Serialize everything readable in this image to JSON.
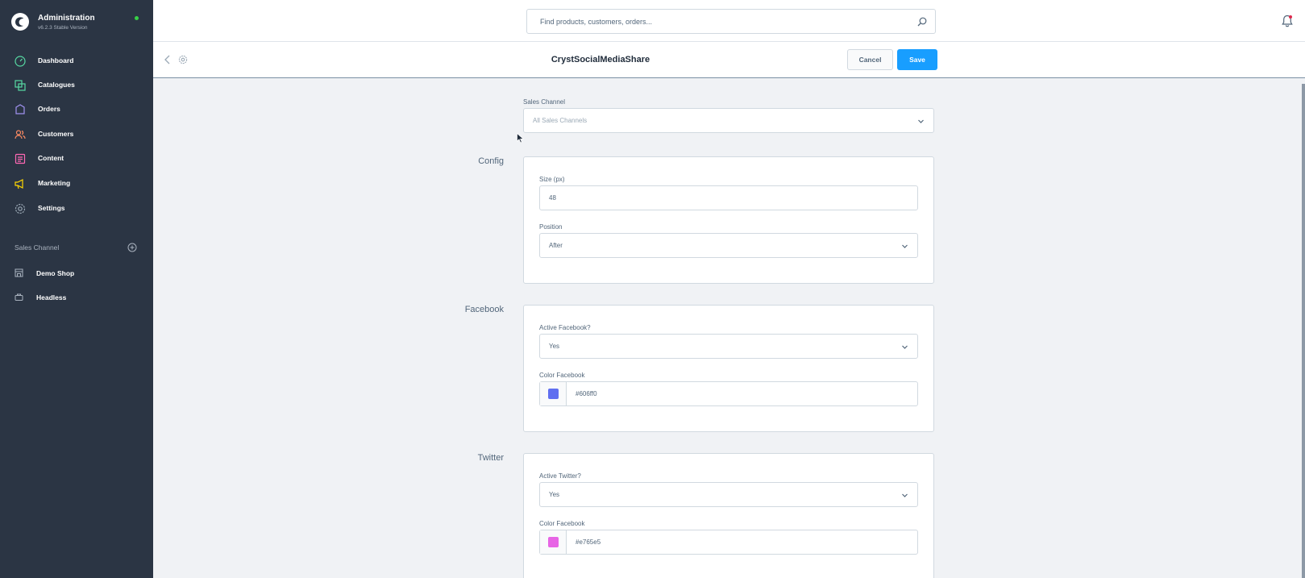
{
  "app": {
    "title": "Administration",
    "version": "v6.2.3 Stable Version"
  },
  "nav": {
    "items": [
      {
        "label": "Dashboard",
        "icon": "dashboard-icon",
        "color": "#57d9a3"
      },
      {
        "label": "Catalogues",
        "icon": "catalogues-icon",
        "color": "#57d9a3"
      },
      {
        "label": "Orders",
        "icon": "orders-icon",
        "color": "#a092f0"
      },
      {
        "label": "Customers",
        "icon": "customers-icon",
        "color": "#f88962"
      },
      {
        "label": "Content",
        "icon": "content-icon",
        "color": "#ff68b4"
      },
      {
        "label": "Marketing",
        "icon": "marketing-icon",
        "color": "#ffd700"
      },
      {
        "label": "Settings",
        "icon": "settings-icon",
        "color": "#9aa8b5"
      }
    ],
    "sales_channel_heading": "Sales Channel",
    "sales_channels": [
      {
        "label": "Demo Shop",
        "icon": "storefront-icon"
      },
      {
        "label": "Headless",
        "icon": "headless-icon"
      }
    ]
  },
  "search": {
    "placeholder": "Find products, customers, orders..."
  },
  "smartbar": {
    "title": "CrystSocialMediaShare",
    "cancel_label": "Cancel",
    "save_label": "Save"
  },
  "form": {
    "sales_channel": {
      "label": "Sales Channel",
      "placeholder": "All Sales Channels"
    },
    "config": {
      "title": "Config",
      "size_label": "Size (px)",
      "size_value": "48",
      "position_label": "Position",
      "position_value": "After"
    },
    "facebook": {
      "title": "Facebook",
      "active_label": "Active Facebook?",
      "active_value": "Yes",
      "color_label": "Color Facebook",
      "color_value": "#606ff0",
      "swatch": "#606ff0"
    },
    "twitter": {
      "title": "Twitter",
      "active_label": "Active Twitter?",
      "active_value": "Yes",
      "color_label": "Color Facebook",
      "color_value": "#e765e5",
      "swatch": "#e765e5"
    }
  },
  "colors": {
    "sidebar_bg": "#2b3544",
    "primary": "#189eff",
    "online": "#37d046"
  }
}
